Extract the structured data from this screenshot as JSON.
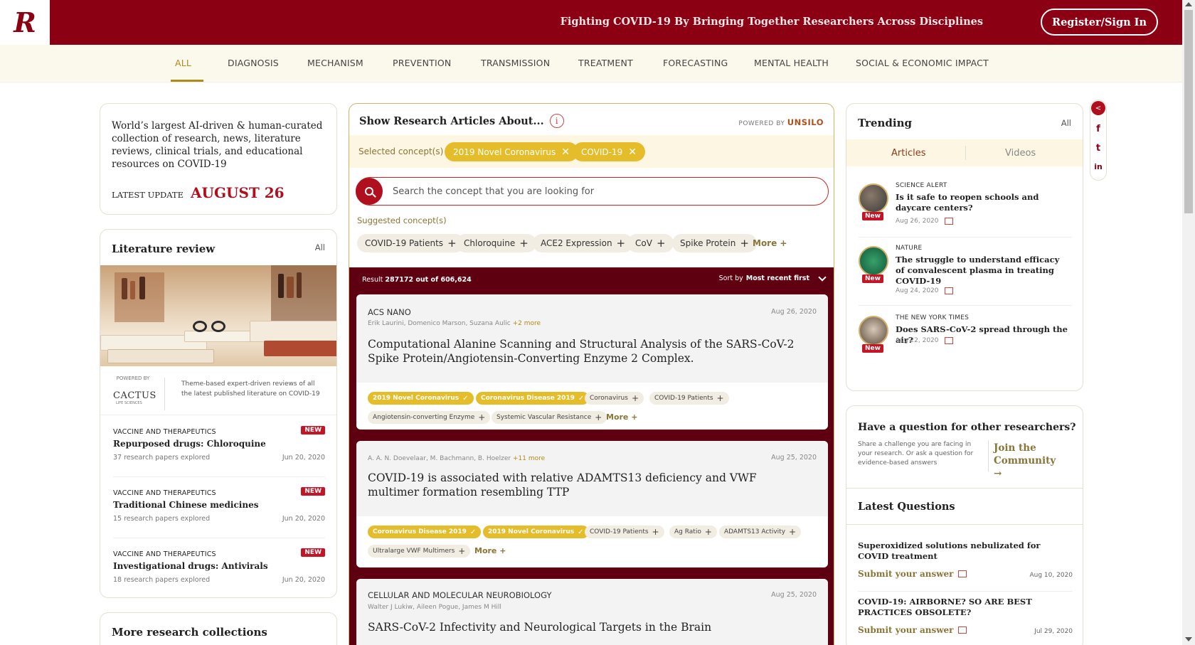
{
  "header": {
    "logo_letter": "R",
    "tagline": "Fighting COVID-19 By Bringing Together Researchers Across Disciplines",
    "signin_label": "Register/Sign In",
    "brand_color": "#8c0014"
  },
  "nav": {
    "items": [
      "ALL",
      "DIAGNOSIS",
      "MECHANISM",
      "PREVENTION",
      "TRANSMISSION",
      "TREATMENT",
      "FORECASTING",
      "MENTAL HEALTH",
      "SOCIAL & ECONOMIC IMPACT"
    ],
    "active": "ALL"
  },
  "about": {
    "text": "World’s largest AI-driven & human-curated collection of research, news, literature reviews, clinical trials, and educational resources on COVID-19",
    "update_label": "LATEST UPDATE",
    "update_date": "AUGUST 26"
  },
  "literature": {
    "title": "Literature review",
    "all_label": "All",
    "powered_label": "POWERED BY",
    "brand": "CACTUS",
    "brand_sub": "LIFE SCIENCES",
    "powered_text": "Theme-based expert-driven reviews of all the latest published literature on COVID-19",
    "items": [
      {
        "category": "VACCINE AND THERAPEUTICS",
        "badge": "NEW",
        "title": "Repurposed drugs: Chloroquine",
        "sub": "37 research papers explored",
        "date": "Jun 20, 2020"
      },
      {
        "category": "VACCINE AND THERAPEUTICS",
        "badge": "NEW",
        "title": "Traditional Chinese medicines",
        "sub": "15 research papers explored",
        "date": "Jun 20, 2020"
      },
      {
        "category": "VACCINE AND THERAPEUTICS",
        "badge": "NEW",
        "title": "Investigational drugs: Antivirals",
        "sub": "18 research papers explored",
        "date": "Jun 20, 2020"
      }
    ]
  },
  "more_collections": {
    "title": "More research collections"
  },
  "research": {
    "heading": "Show Research Articles About...",
    "info_icon": "info-icon",
    "powered_by": "POWERED BY",
    "powered_brand": "UNSILO",
    "selected_label": "Selected concept(s)",
    "selected": [
      "2019 Novel Coronavirus",
      "COVID-19"
    ],
    "search_placeholder": "Search the concept that you are looking for",
    "suggested_label": "Suggested concept(s)",
    "suggested": [
      "COVID-19 Patients",
      "Chloroquine",
      "ACE2 Expression",
      "CoV",
      "Spike Protein"
    ],
    "suggested_more": "More +",
    "result_prefix": "Result",
    "result_count": "287172 out of 606,624",
    "sort_prefix": "Sort by",
    "sort_value": "Most recent first"
  },
  "articles": [
    {
      "source": "ACS NANO",
      "date": "Aug 26, 2020",
      "authors": "Erik Laurini, Domenico Marson, Suzana Aulic",
      "authors_more": "+2 more",
      "title": "Computational Alanine Scanning and Structural Analysis of the SARS-CoV-2 Spike Protein/Angiotensin-Converting Enzyme 2 Complex.",
      "selected_tags": [
        "2019 Novel Coronavirus",
        "Coronavirus Disease 2019"
      ],
      "tags": [
        "Coronavirus",
        "COVID-19 Patients",
        "Angiotensin-converting Enzyme",
        "Systemic Vascular Resistance"
      ],
      "more": "More +"
    },
    {
      "source": "",
      "date": "Aug 25, 2020",
      "authors": "A. A. N. Doevelaar, M. Bachmann, B. Hoelzer",
      "authors_more": "+11 more",
      "title": "COVID-19 is associated with relative ADAMTS13 deficiency and VWF multimer formation resembling TTP",
      "selected_tags": [
        "Coronavirus Disease 2019",
        "2019 Novel Coronavirus"
      ],
      "tags": [
        "COVID-19 Patients",
        "Ag Ratio",
        "ADAMTS13 Activity",
        "Ultralarge VWF Multimers"
      ],
      "more": "More +"
    },
    {
      "source": "CELLULAR AND MOLECULAR NEUROBIOLOGY",
      "date": "Aug 25, 2020",
      "authors": "Walter J Lukiw, Aileen Pogue, James M Hill",
      "authors_more": "",
      "title": "SARS-CoV-2 Infectivity and Neurological Targets in the Brain"
    }
  ],
  "trending": {
    "title": "Trending",
    "all_label": "All",
    "tabs": [
      "Articles",
      "Videos"
    ],
    "active_tab": "Articles",
    "items": [
      {
        "source": "SCIENCE ALERT",
        "title": "Is it safe to reopen schools and daycare centers?",
        "date": "Aug 26, 2020",
        "badge": "New"
      },
      {
        "source": "NATURE",
        "title": "The struggle to understand efficacy of convalescent plasma in treating COVID-19",
        "date": "Aug 24, 2020",
        "badge": "New"
      },
      {
        "source": "THE NEW YORK TIMES",
        "title": "Does SARS-CoV-2 spread through the air?",
        "date": "Aug 22, 2020",
        "badge": "New"
      }
    ]
  },
  "questions": {
    "heading": "Have a question for other researchers?",
    "sub": "Share a challenge you are facing in your research. Or ask a question for evidence-based answers",
    "join_label": "Join the Community",
    "latest_title": "Latest Questions",
    "answer_label": "Submit your answer",
    "items": [
      {
        "title": "Superoxidized solutions nebulizated for COVID treatment",
        "date": "Aug 10, 2020"
      },
      {
        "title": "COVID-19: AIRBORNE? SO ARE BEST PRACTICES OBSOLETE?",
        "date": "Jul 29, 2020"
      }
    ]
  },
  "share": {
    "icons": [
      "share-icon",
      "facebook-icon",
      "twitter-icon",
      "linkedin-icon"
    ],
    "glyphs": [
      "<",
      "f",
      "t",
      "in"
    ]
  }
}
